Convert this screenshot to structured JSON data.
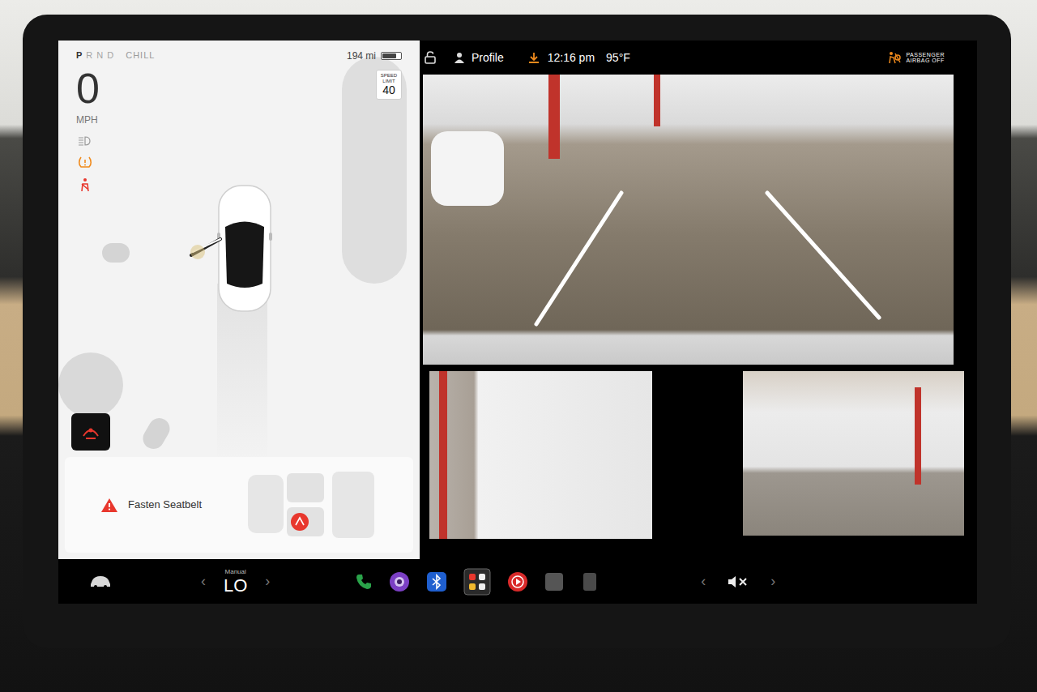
{
  "drive": {
    "gears": [
      {
        "label": "P",
        "selected": true
      },
      {
        "label": "R",
        "selected": false
      },
      {
        "label": "N",
        "selected": false
      },
      {
        "label": "D",
        "selected": false
      }
    ],
    "mode": "CHILL"
  },
  "speed": {
    "value": "0",
    "unit": "MPH"
  },
  "battery": {
    "range": "194 mi",
    "level": 0.75
  },
  "speed_limit": {
    "label": "SPEED LIMIT",
    "value": "40"
  },
  "alert": {
    "text": "Fasten Seatbelt"
  },
  "status_bar": {
    "locked": false,
    "profile": "Profile",
    "time": "12:16 pm",
    "temperature": "95°F",
    "airbag": [
      "PASSENGER",
      "AIRBAG OFF"
    ]
  },
  "climate": {
    "mode": "Manual",
    "fan": "LO",
    "prev": "‹",
    "next": "›"
  },
  "volume": {
    "muted": true,
    "prev": "‹",
    "next": "›"
  }
}
